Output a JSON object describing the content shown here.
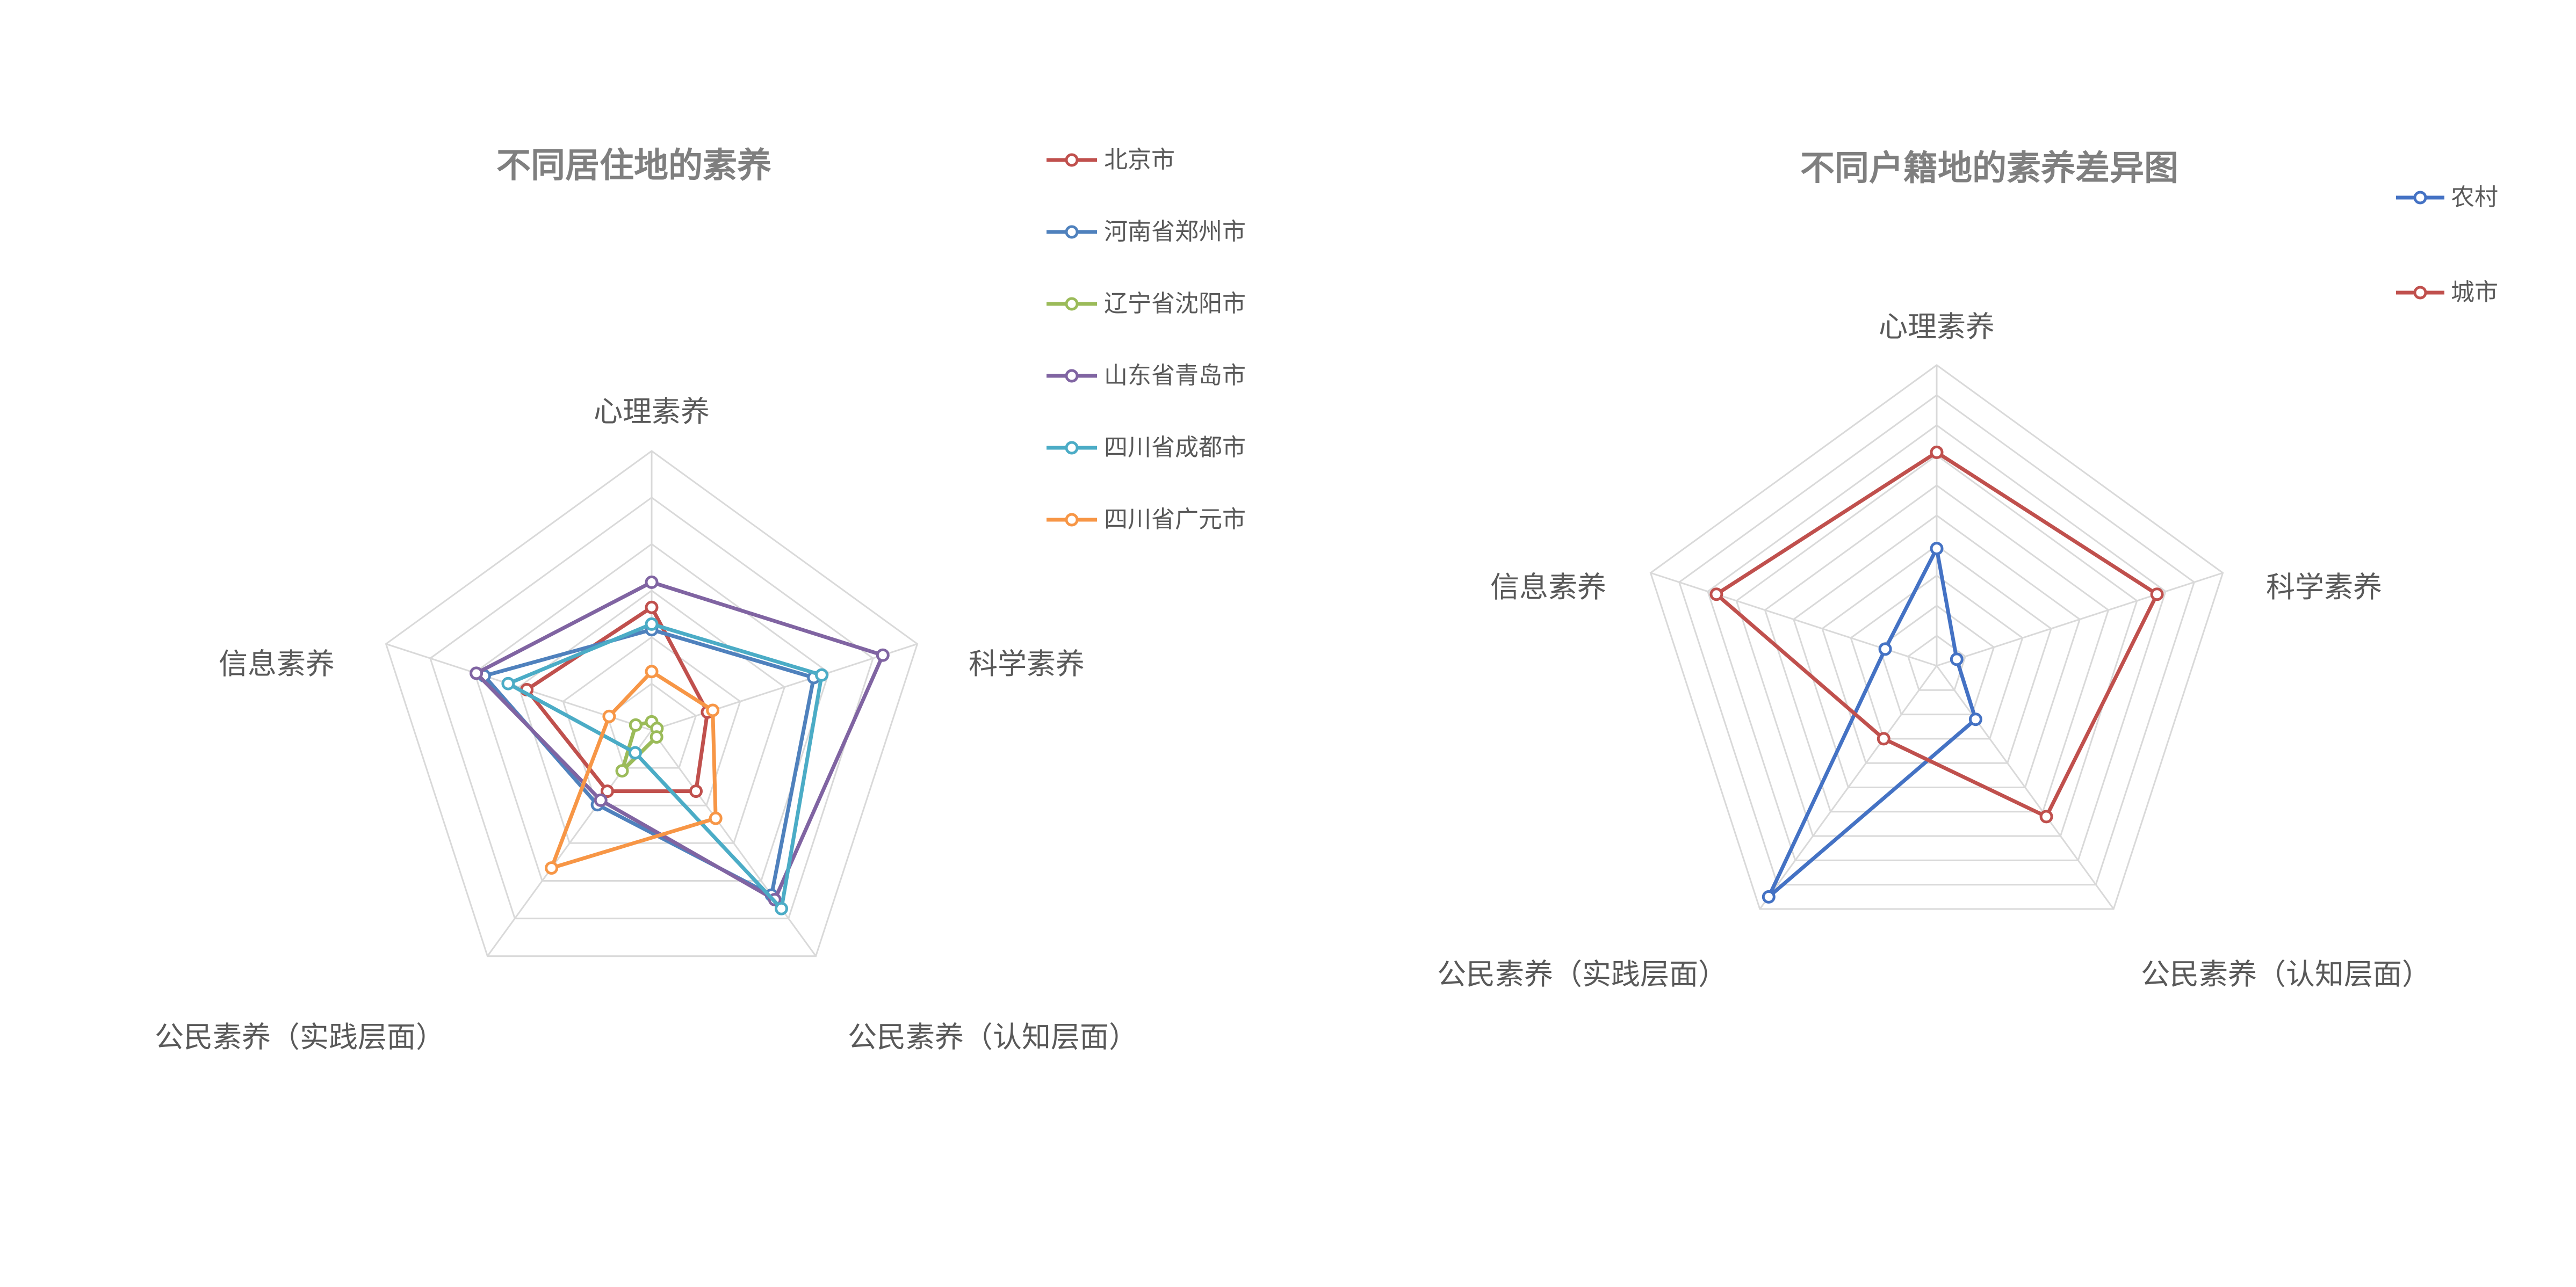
{
  "chart_data": [
    {
      "type": "radar",
      "title": "不同居住地的素养",
      "axes": [
        "心理素养",
        "科学素养",
        "公民素养（认知层面）",
        "公民素养（实践层面）",
        "信息素养"
      ],
      "range": [
        0,
        1
      ],
      "grid": true,
      "legend_position": "top-right",
      "series": [
        {
          "name": "北京市",
          "color": "#c0504d",
          "values": [
            0.44,
            0.21,
            0.27,
            0.27,
            0.47
          ]
        },
        {
          "name": "河南省郑州市",
          "color": "#4f81bd",
          "values": [
            0.36,
            0.61,
            0.73,
            0.33,
            0.63
          ]
        },
        {
          "name": "辽宁省沈阳市",
          "color": "#9bbb59",
          "values": [
            0.03,
            0.02,
            0.03,
            0.18,
            0.06
          ]
        },
        {
          "name": "山东省青岛市",
          "color": "#8064a2",
          "values": [
            0.53,
            0.87,
            0.75,
            0.31,
            0.66
          ]
        },
        {
          "name": "四川省成都市",
          "color": "#4bacc6",
          "values": [
            0.38,
            0.64,
            0.79,
            0.1,
            0.54
          ]
        },
        {
          "name": "四川省广元市",
          "color": "#f79646",
          "values": [
            0.21,
            0.23,
            0.39,
            0.61,
            0.16
          ]
        }
      ]
    },
    {
      "type": "radar",
      "title": "不同户籍地的素养差异图",
      "axes": [
        "心理素养",
        "科学素养",
        "公民素养（认知层面）",
        "公民素养（实践层面）",
        "信息素养"
      ],
      "range": [
        0,
        1
      ],
      "grid": true,
      "legend_position": "top-right",
      "series": [
        {
          "name": "农村",
          "color": "#4472c4",
          "values": [
            0.39,
            0.07,
            0.22,
            0.95,
            0.18
          ]
        },
        {
          "name": "城市",
          "color": "#c0504d",
          "values": [
            0.71,
            0.77,
            0.62,
            0.3,
            0.77
          ]
        }
      ]
    }
  ]
}
